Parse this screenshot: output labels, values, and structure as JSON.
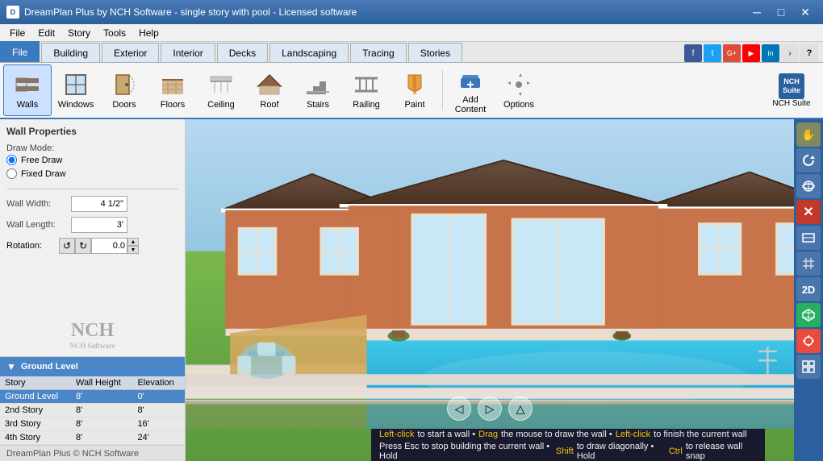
{
  "titleBar": {
    "title": "DreamPlan Plus by NCH Software - single story with pool - Licensed software",
    "iconText": "D",
    "winBtns": [
      "─",
      "□",
      "✕"
    ]
  },
  "menuBar": {
    "items": [
      "File",
      "Edit",
      "Story",
      "Tools",
      "Help"
    ]
  },
  "tabs": {
    "items": [
      "File",
      "Building",
      "Exterior",
      "Interior",
      "Decks",
      "Landscaping",
      "Tracing",
      "Stories"
    ],
    "active": 0
  },
  "ribbon": {
    "tools": [
      {
        "id": "walls",
        "label": "Walls",
        "icon": "🧱",
        "active": true
      },
      {
        "id": "windows",
        "label": "Windows",
        "icon": "🪟"
      },
      {
        "id": "doors",
        "label": "Doors",
        "icon": "🚪"
      },
      {
        "id": "floors",
        "label": "Floors",
        "icon": "▦"
      },
      {
        "id": "ceiling",
        "label": "Ceiling",
        "icon": "⬜"
      },
      {
        "id": "roof",
        "label": "Roof",
        "icon": "🏠"
      },
      {
        "id": "stairs",
        "label": "Stairs",
        "icon": "≡"
      },
      {
        "id": "railing",
        "label": "Railing",
        "icon": "⊟"
      },
      {
        "id": "paint",
        "label": "Paint",
        "icon": "🎨"
      },
      {
        "id": "add-content",
        "label": "Add Content",
        "icon": "📦"
      },
      {
        "id": "options",
        "label": "Options",
        "icon": "⚙️"
      }
    ],
    "nchSuite": "NCH Suite"
  },
  "wallProperties": {
    "title": "Wall Properties",
    "drawModeLabel": "Draw Mode:",
    "modes": [
      {
        "id": "free-draw",
        "label": "Free Draw",
        "checked": true
      },
      {
        "id": "fixed-draw",
        "label": "Fixed Draw",
        "checked": false
      }
    ],
    "wallWidth": {
      "label": "Wall Width:",
      "value": "4 1/2\""
    },
    "wallLength": {
      "label": "Wall Length:",
      "value": "3'"
    },
    "rotation": {
      "label": "Rotation:",
      "value": "0.0"
    }
  },
  "nchLogo": "NCH",
  "groundLevel": {
    "header": "Ground Level",
    "tableHeaders": [
      "Story",
      "Wall Height",
      "Elevation"
    ],
    "rows": [
      {
        "story": "Ground Level",
        "wallHeight": "8'",
        "elevation": "0'",
        "active": true
      },
      {
        "story": "2nd Story",
        "wallHeight": "8'",
        "elevation": "8'"
      },
      {
        "story": "3rd Story",
        "wallHeight": "8'",
        "elevation": "16'"
      },
      {
        "story": "4th Story",
        "wallHeight": "8'",
        "elevation": "24'"
      }
    ]
  },
  "statusBarLeft": "DreamPlan Plus © NCH Software",
  "rightToolbar": {
    "buttons": [
      {
        "id": "pointer",
        "icon": "✋",
        "active": true
      },
      {
        "id": "rotate",
        "icon": "↻"
      },
      {
        "id": "orbit",
        "icon": "⟳"
      },
      {
        "id": "delete",
        "icon": "✕",
        "class": "red"
      },
      {
        "id": "walls-toggle",
        "icon": "◫"
      },
      {
        "id": "grid",
        "icon": "⊞"
      },
      {
        "id": "2d",
        "label": "2D"
      },
      {
        "id": "3d",
        "icon": "⬡",
        "class": "green"
      },
      {
        "id": "snap",
        "icon": "🧲",
        "class": "red2"
      },
      {
        "id": "info",
        "icon": "⊞"
      }
    ]
  },
  "instructionBar": {
    "line1": {
      "parts": [
        {
          "text": "Left-click",
          "color": "yellow"
        },
        {
          "text": " to start a wall • ",
          "color": "white"
        },
        {
          "text": "Drag",
          "color": "yellow"
        },
        {
          "text": " the mouse to draw the wall • ",
          "color": "white"
        },
        {
          "text": "Left-click",
          "color": "yellow"
        },
        {
          "text": " to finish the current wall",
          "color": "white"
        }
      ]
    },
    "line2": {
      "parts": [
        {
          "text": "Press Esc to stop building the current wall • Hold ",
          "color": "white"
        },
        {
          "text": "Shift",
          "color": "yellow"
        },
        {
          "text": " to draw diagonally • Hold ",
          "color": "white"
        },
        {
          "text": "Ctrl",
          "color": "yellow"
        },
        {
          "text": " to release wall snap",
          "color": "white"
        }
      ]
    }
  },
  "navArrows": [
    "◁",
    "▷",
    "△"
  ]
}
